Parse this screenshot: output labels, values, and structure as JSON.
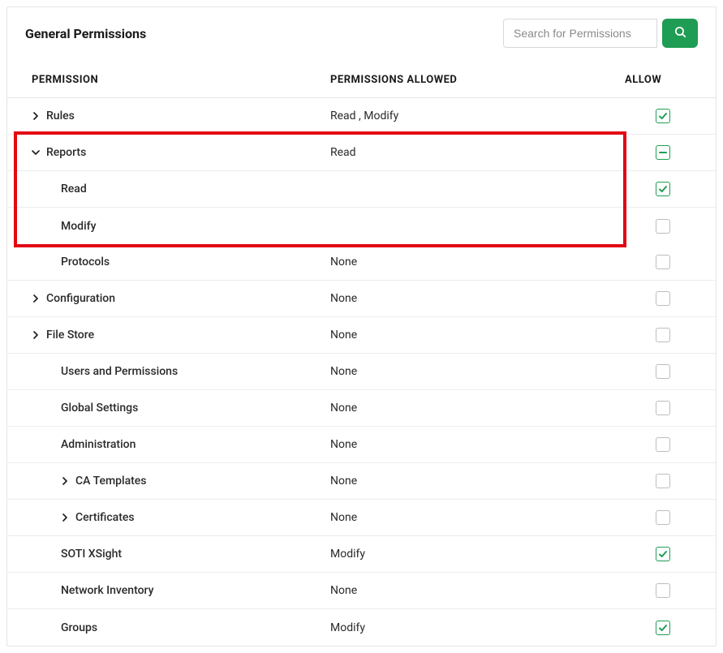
{
  "header": {
    "title": "General Permissions",
    "search_placeholder": "Search for Permissions"
  },
  "columns": {
    "permission": "PERMISSION",
    "permissions_allowed": "PERMISSIONS ALLOWED",
    "allow": "ALLOW"
  },
  "rows": [
    {
      "id": "rules",
      "label": "Rules",
      "indent": 0,
      "chevron": "right",
      "allowed": "Read , Modify",
      "state": "checked",
      "highlight": false
    },
    {
      "id": "reports",
      "label": "Reports",
      "indent": 0,
      "chevron": "down",
      "allowed": "Read",
      "state": "indeterminate",
      "highlight": true
    },
    {
      "id": "reports-read",
      "label": "Read",
      "indent": 1,
      "chevron": "none",
      "allowed": "",
      "state": "checked",
      "highlight": true
    },
    {
      "id": "reports-modify",
      "label": "Modify",
      "indent": 1,
      "chevron": "none",
      "allowed": "",
      "state": "unchecked",
      "highlight": true
    },
    {
      "id": "protocols",
      "label": "Protocols",
      "indent": 1,
      "chevron": "none",
      "allowed": "None",
      "state": "unchecked",
      "highlight": false
    },
    {
      "id": "configuration",
      "label": "Configuration",
      "indent": 0,
      "chevron": "right",
      "allowed": "None",
      "state": "unchecked",
      "highlight": false
    },
    {
      "id": "file-store",
      "label": "File Store",
      "indent": 0,
      "chevron": "right",
      "allowed": "None",
      "state": "unchecked",
      "highlight": false
    },
    {
      "id": "users-permissions",
      "label": "Users and Permissions",
      "indent": 1,
      "chevron": "none",
      "allowed": "None",
      "state": "unchecked",
      "highlight": false
    },
    {
      "id": "global-settings",
      "label": "Global Settings",
      "indent": 1,
      "chevron": "none",
      "allowed": "None",
      "state": "unchecked",
      "highlight": false
    },
    {
      "id": "administration",
      "label": "Administration",
      "indent": 1,
      "chevron": "none",
      "allowed": "None",
      "state": "unchecked",
      "highlight": false
    },
    {
      "id": "ca-templates",
      "label": "CA Templates",
      "indent": 2,
      "chevron": "right",
      "allowed": "None",
      "state": "unchecked",
      "highlight": false
    },
    {
      "id": "certificates",
      "label": "Certificates",
      "indent": 2,
      "chevron": "right",
      "allowed": "None",
      "state": "unchecked",
      "highlight": false
    },
    {
      "id": "soti-xsight",
      "label": "SOTI XSight",
      "indent": 1,
      "chevron": "none",
      "allowed": "Modify",
      "state": "checked",
      "highlight": false
    },
    {
      "id": "network-inventory",
      "label": "Network Inventory",
      "indent": 1,
      "chevron": "none",
      "allowed": "None",
      "state": "unchecked",
      "highlight": false
    },
    {
      "id": "groups",
      "label": "Groups",
      "indent": 1,
      "chevron": "none",
      "allowed": "Modify",
      "state": "checked",
      "highlight": false
    }
  ]
}
